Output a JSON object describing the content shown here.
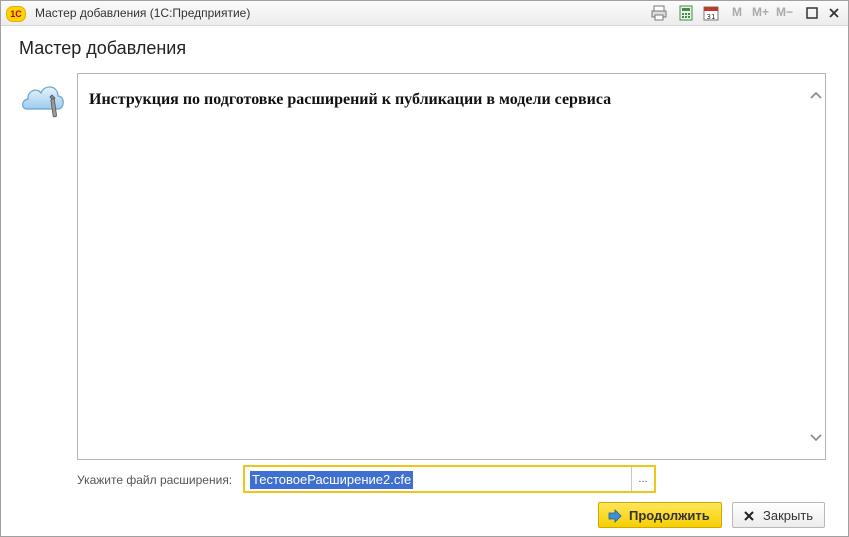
{
  "window": {
    "title": "Мастер добавления  (1С:Предприятие)",
    "logo_text": "1С",
    "toolbar": {
      "m_label": "M",
      "m_plus_label": "M+",
      "m_minus_label": "M−"
    }
  },
  "form": {
    "title": "Мастер добавления",
    "instruction_title": "Инструкция по подготовке расширений к публикации в модели сервиса",
    "file_label": "Укажите файл расширения:",
    "file_value": "ТестовоеРасширение2.cfe",
    "select_button": "...",
    "continue_button": "Продолжить",
    "close_button": "Закрыть"
  },
  "colors": {
    "accent_yellow": "#f6cf00",
    "selection_blue": "#3f6fd0"
  }
}
